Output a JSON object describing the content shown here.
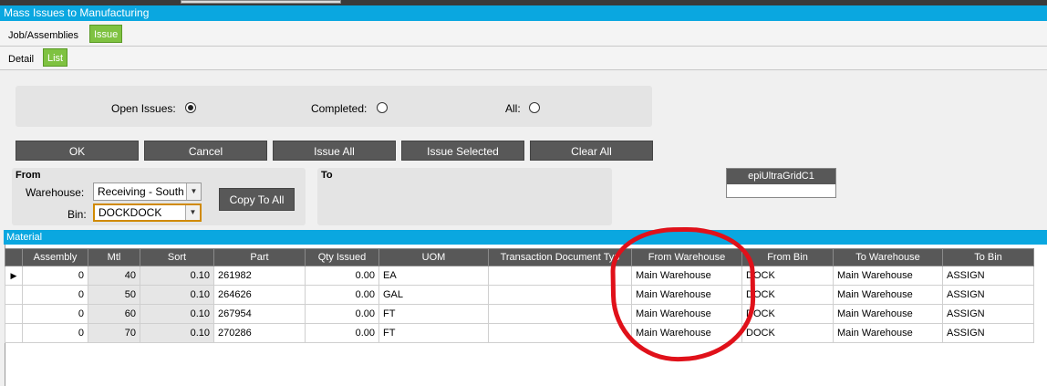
{
  "window": {
    "title": "Mass Issues to Manufacturing"
  },
  "tabs_level1": [
    {
      "label": "Job/Assemblies",
      "active": false
    },
    {
      "label": "Issue",
      "active": true
    }
  ],
  "tabs_level2": [
    {
      "label": "Detail",
      "active": false
    },
    {
      "label": "List",
      "active": true
    }
  ],
  "filter": {
    "open_label": "Open Issues:",
    "completed_label": "Completed:",
    "all_label": "All:",
    "selected": "open"
  },
  "buttons": {
    "ok": "OK",
    "cancel": "Cancel",
    "issue_all": "Issue All",
    "issue_selected": "Issue Selected",
    "clear_all": "Clear All",
    "copy_to_all": "Copy To All"
  },
  "from": {
    "title": "From",
    "warehouse_label": "Warehouse:",
    "warehouse_value": "Receiving - South",
    "bin_label": "Bin:",
    "bin_value": "DOCKDOCK"
  },
  "to": {
    "title": "To"
  },
  "ultragrid": {
    "label": "epiUltraGridC1"
  },
  "material": {
    "title": "Material",
    "columns": [
      "Assembly",
      "Mtl",
      "Sort",
      "Part",
      "Qty Issued",
      "UOM",
      "Transaction Document Typ",
      "From Warehouse",
      "From Bin",
      "To Warehouse",
      "To Bin"
    ],
    "rows": [
      {
        "assembly": "0",
        "mtl": "40",
        "sort": "0.10",
        "part": "261982",
        "qty": "0.00",
        "uom": "EA",
        "trans_doc": "",
        "from_wh": "Main Warehouse",
        "from_bin": "DOCK",
        "to_wh": "Main Warehouse",
        "to_bin": "ASSIGN"
      },
      {
        "assembly": "0",
        "mtl": "50",
        "sort": "0.10",
        "part": "264626",
        "qty": "0.00",
        "uom": "GAL",
        "trans_doc": "",
        "from_wh": "Main Warehouse",
        "from_bin": "DOCK",
        "to_wh": "Main Warehouse",
        "to_bin": "ASSIGN"
      },
      {
        "assembly": "0",
        "mtl": "60",
        "sort": "0.10",
        "part": "267954",
        "qty": "0.00",
        "uom": "FT",
        "trans_doc": "",
        "from_wh": "Main Warehouse",
        "from_bin": "DOCK",
        "to_wh": "Main Warehouse",
        "to_bin": "ASSIGN"
      },
      {
        "assembly": "0",
        "mtl": "70",
        "sort": "0.10",
        "part": "270286",
        "qty": "0.00",
        "uom": "FT",
        "trans_doc": "",
        "from_wh": "Main Warehouse",
        "from_bin": "DOCK",
        "to_wh": "Main Warehouse",
        "to_bin": "ASSIGN"
      }
    ]
  },
  "colors": {
    "title_bar": "#0aa7e0",
    "active_tab": "#7fc241",
    "button": "#585858",
    "annotation": "#e0111a"
  }
}
